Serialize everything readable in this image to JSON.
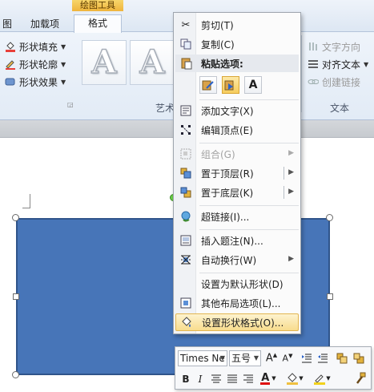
{
  "ribbon": {
    "tab_partial": "图",
    "tab_addins": "加载项",
    "context_header": "绘图工具",
    "tab_format": "格式",
    "shape_fill": "形状填充",
    "shape_outline": "形状轮廓",
    "shape_effects": "形状效果",
    "art_group_label_partial": "艺术",
    "text_direction": "文字方向",
    "align_text": "对齐文本",
    "create_link": "创建链接",
    "text_group_label": "文本",
    "wordart_letter": "A"
  },
  "context_menu": {
    "items": [
      {
        "label": "剪切(T)",
        "icon": "scissors-icon",
        "enabled": true
      },
      {
        "label": "复制(C)",
        "icon": "copy-icon",
        "enabled": true
      },
      {
        "label": "粘贴选项:",
        "icon": "paste-icon",
        "enabled": true
      },
      {
        "label": "添加文字(X)",
        "icon": "text-box-icon",
        "enabled": true
      },
      {
        "label": "编辑顶点(E)",
        "icon": "edit-points-icon",
        "enabled": true
      },
      {
        "label": "组合(G)",
        "icon": "group-icon",
        "enabled": false
      },
      {
        "label": "置于顶层(R)",
        "icon": "bring-to-front-icon",
        "enabled": true
      },
      {
        "label": "置于底层(K)",
        "icon": "send-to-back-icon",
        "enabled": true
      },
      {
        "label": "超链接(I)...",
        "icon": "hyperlink-icon",
        "enabled": true
      },
      {
        "label": "插入题注(N)...",
        "icon": "caption-icon",
        "enabled": true
      },
      {
        "label": "自动换行(W)",
        "icon": "wrap-text-icon",
        "enabled": true
      },
      {
        "label": "设置为默认形状(D)",
        "icon": "",
        "enabled": true
      },
      {
        "label": "其他布局选项(L)...",
        "icon": "layout-options-icon",
        "enabled": true
      },
      {
        "label": "设置形状格式(O)...",
        "icon": "format-shape-icon",
        "enabled": true
      }
    ],
    "paste_options": [
      "paste-use-destination-theme-icon",
      "paste-keep-source-icon",
      "paste-keep-text-only-icon"
    ],
    "paste_text_only_letter": "A",
    "highlighted_item": "设置形状格式(O)..."
  },
  "mini_toolbar": {
    "font_name": "Times Ne",
    "font_size": "五号",
    "bold": "B",
    "italic": "I",
    "font_color_letter": "A",
    "colors": {
      "font_color": "#e01010",
      "highlight": "#f2d21d",
      "shading": "#f0c040"
    }
  },
  "colors": {
    "shape_fill": "#4775b8",
    "shape_border": "#2f548a",
    "menu_highlight": "#f8dc8d",
    "context_header": "#efb43c"
  }
}
